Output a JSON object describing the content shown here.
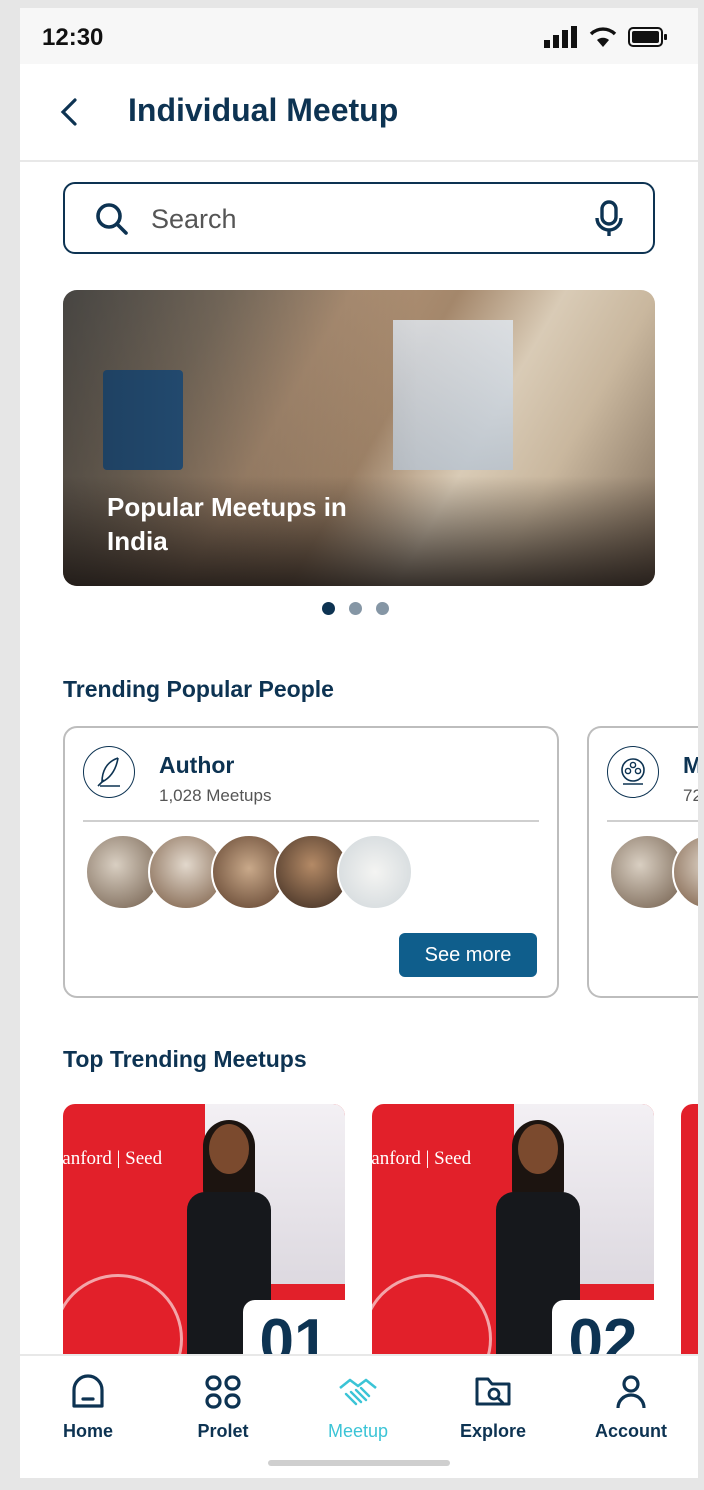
{
  "status_bar": {
    "time": "12:30"
  },
  "header": {
    "title": "Individual Meetup"
  },
  "search": {
    "placeholder": "Search"
  },
  "banner": {
    "title": "Popular Meetups in India",
    "slides": 3,
    "active_slide": 1
  },
  "trending_people": {
    "title": "Trending Popular People",
    "cards": [
      {
        "name": "Author",
        "count": "1,028 Meetups",
        "icon": "feather-quill-icon",
        "see_more": "See more"
      },
      {
        "name": "M",
        "count": "72",
        "icon": "film-reel-icon"
      }
    ]
  },
  "top_meetups": {
    "title": "Top Trending Meetups",
    "items": [
      {
        "number": "01",
        "brand": "tanford | Seed"
      },
      {
        "number": "02",
        "brand": "tanford | Seed"
      }
    ]
  },
  "nav": {
    "items": [
      {
        "label": "Home",
        "icon": "home-icon"
      },
      {
        "label": "Prolet",
        "icon": "grid-icon"
      },
      {
        "label": "Meetup",
        "icon": "handshake-icon",
        "active": true
      },
      {
        "label": "Explore",
        "icon": "folder-search-icon"
      },
      {
        "label": "Account",
        "icon": "person-icon"
      }
    ]
  },
  "colors": {
    "primary": "#0d3352",
    "accent": "#3bc4d6",
    "button": "#0f5e8c",
    "card_red": "#e2202a"
  }
}
